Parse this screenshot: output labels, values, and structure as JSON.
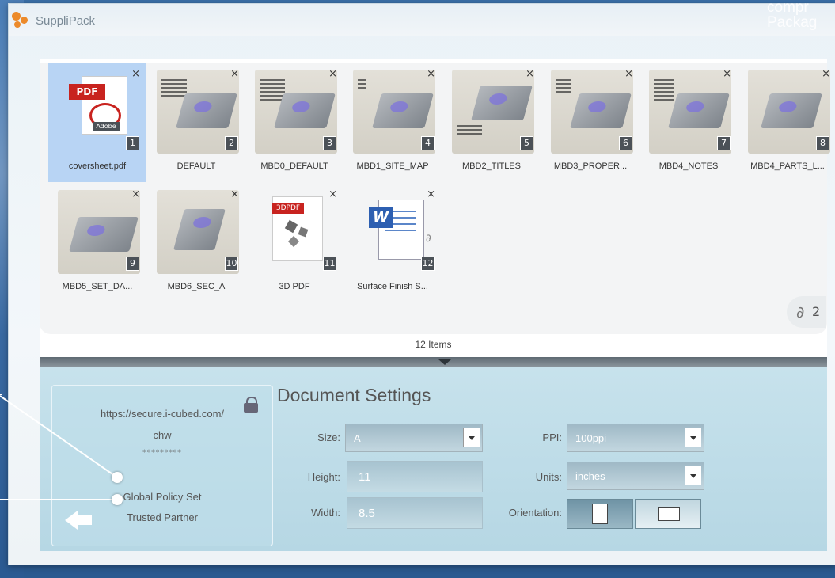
{
  "app": {
    "title": "SuppliPack",
    "corner_text": [
      "compr",
      "Packag"
    ]
  },
  "tray": {
    "items": [
      {
        "label": "coversheet.pdf",
        "number": "1",
        "kind": "pdf",
        "badge": "PDF",
        "sub": "Adobe"
      },
      {
        "label": "DEFAULT",
        "number": "2",
        "kind": "model"
      },
      {
        "label": "MBD0_DEFAULT",
        "number": "3",
        "kind": "model"
      },
      {
        "label": "MBD1_SITE_MAP",
        "number": "4",
        "kind": "model"
      },
      {
        "label": "MBD2_TITLES",
        "number": "5",
        "kind": "model"
      },
      {
        "label": "MBD3_PROPER...",
        "number": "6",
        "kind": "model"
      },
      {
        "label": "MBD4_NOTES",
        "number": "7",
        "kind": "model"
      },
      {
        "label": "MBD4_PARTS_L...",
        "number": "8",
        "kind": "model"
      },
      {
        "label": "MBD5_SET_DA...",
        "number": "9",
        "kind": "model"
      },
      {
        "label": "MBD6_SEC_A",
        "number": "10",
        "kind": "model"
      },
      {
        "label": "3D PDF",
        "number": "11",
        "kind": "3dpdf",
        "badge": "3DPDF"
      },
      {
        "label": "Surface Finish S...",
        "number": "12",
        "kind": "word",
        "badge": "W"
      }
    ],
    "close_symbol": "×",
    "items_count": "12 Items",
    "attachments": {
      "icon": "paperclip-icon",
      "count": "2"
    }
  },
  "policy": {
    "url": "https://secure.i-cubed.com/",
    "user": "chw",
    "password_mask": "*********",
    "policy_status": "Global Policy Set",
    "partner_status": "Trusted Partner"
  },
  "settings": {
    "title": "Document Settings",
    "size_label": "Size:",
    "size_value": "A",
    "ppi_label": "PPI:",
    "ppi_value": "100ppi",
    "height_label": "Height:",
    "height_value": "11",
    "units_label": "Units:",
    "units_value": "inches",
    "width_label": "Width:",
    "width_value": "8.5",
    "orientation_label": "Orientation:"
  },
  "colors": {
    "selected_tile": "#b8d4f4",
    "panel": "#c7e2ec",
    "accent_orange": "#ec8a2a"
  }
}
